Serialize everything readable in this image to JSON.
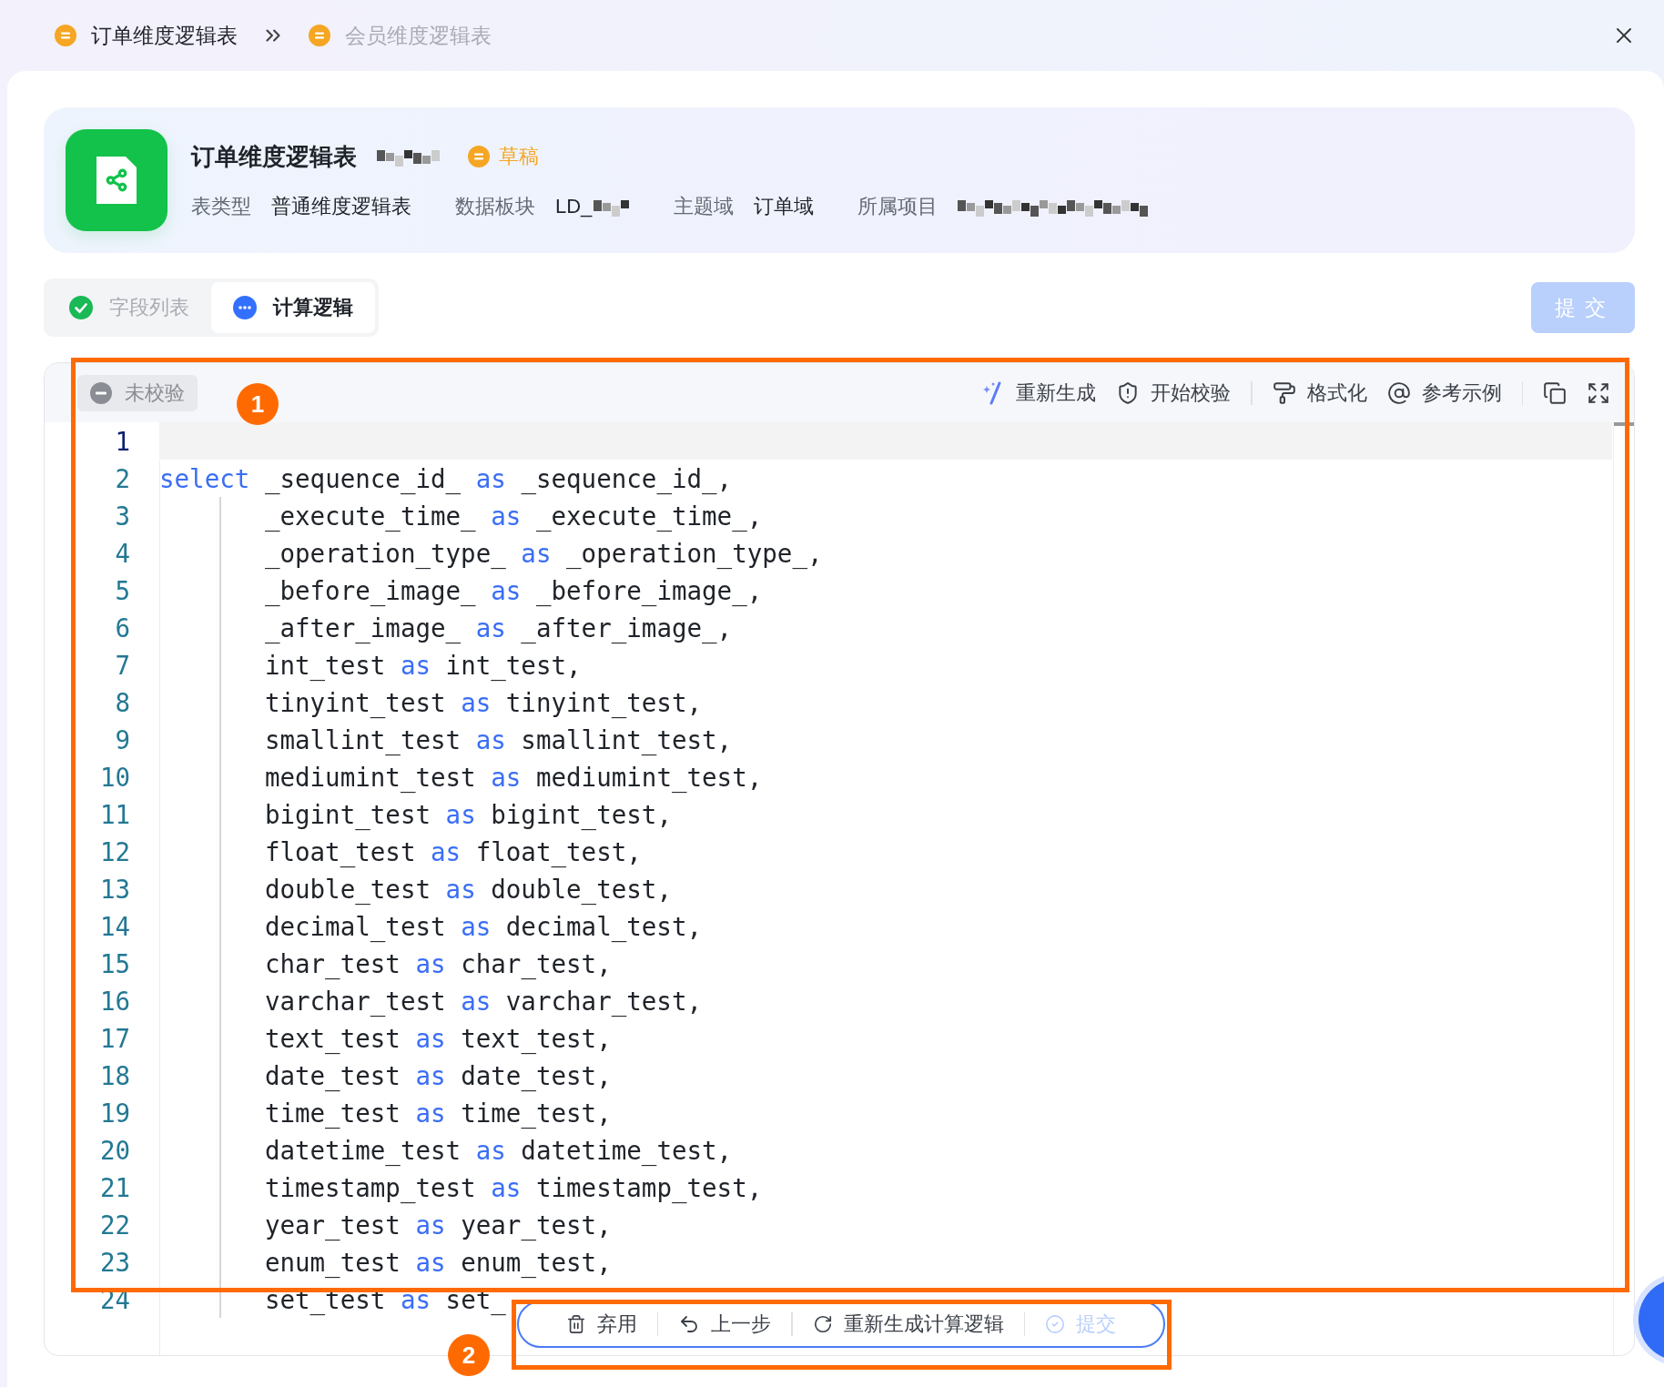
{
  "breadcrumb": [
    {
      "label": "订单维度逻辑表",
      "selected": true
    },
    {
      "label": "会员维度逻辑表",
      "selected": false
    }
  ],
  "header": {
    "title": "订单维度逻辑表",
    "title_redacted": true,
    "status": {
      "label": "草稿",
      "color": "#f5a623"
    },
    "meta": [
      {
        "label": "表类型",
        "value": "普通维度逻辑表",
        "redacted": false
      },
      {
        "label": "数据板块",
        "value": "LD_",
        "redacted": true
      },
      {
        "label": "主题域",
        "value": "订单域",
        "redacted": false
      },
      {
        "label": "所属项目",
        "redacted": true
      }
    ]
  },
  "steps": [
    {
      "label": "字段列表",
      "selected": false
    },
    {
      "label": "计算逻辑",
      "selected": true
    }
  ],
  "submit": {
    "label": "提交",
    "disabled": true
  },
  "editor": {
    "validation": {
      "label": "未校验"
    },
    "toolbar": [
      [
        {
          "kind": "regenerate",
          "label": "重新生成"
        },
        {
          "kind": "validate",
          "label": "开始校验"
        }
      ],
      [
        {
          "kind": "format",
          "label": "格式化"
        },
        {
          "kind": "example",
          "label": "参考示例"
        }
      ],
      [
        {
          "kind": "copy"
        },
        {
          "kind": "fullscreen"
        }
      ]
    ],
    "lines": [
      {
        "number": "1",
        "active": true,
        "indented": false
      },
      {
        "number": "2",
        "active": false,
        "indented": false,
        "parts": [
          {
            "kind": "keyword",
            "text": "select"
          },
          {
            "kind": "name",
            "text": " _sequence_id_ "
          },
          {
            "kind": "keyword",
            "text": "as"
          },
          {
            "kind": "name",
            "text": " _sequence_id_,"
          }
        ]
      },
      {
        "number": "3",
        "active": false,
        "indented": true,
        "parts": [
          {
            "kind": "name",
            "text": "_execute_time_ "
          },
          {
            "kind": "keyword",
            "text": "as"
          },
          {
            "kind": "name",
            "text": " _execute_time_,"
          }
        ]
      },
      {
        "number": "4",
        "active": false,
        "indented": true,
        "parts": [
          {
            "kind": "name",
            "text": "_operation_type_ "
          },
          {
            "kind": "keyword",
            "text": "as"
          },
          {
            "kind": "name",
            "text": " _operation_type_,"
          }
        ]
      },
      {
        "number": "5",
        "active": false,
        "indented": true,
        "parts": [
          {
            "kind": "name",
            "text": "_before_image_ "
          },
          {
            "kind": "keyword",
            "text": "as"
          },
          {
            "kind": "name",
            "text": " _before_image_,"
          }
        ]
      },
      {
        "number": "6",
        "active": false,
        "indented": true,
        "parts": [
          {
            "kind": "name",
            "text": "_after_image_ "
          },
          {
            "kind": "keyword",
            "text": "as"
          },
          {
            "kind": "name",
            "text": " _after_image_,"
          }
        ]
      },
      {
        "number": "7",
        "active": false,
        "indented": true,
        "parts": [
          {
            "kind": "name",
            "text": "int_test "
          },
          {
            "kind": "keyword",
            "text": "as"
          },
          {
            "kind": "name",
            "text": " int_test,"
          }
        ]
      },
      {
        "number": "8",
        "active": false,
        "indented": true,
        "parts": [
          {
            "kind": "name",
            "text": "tinyint_test "
          },
          {
            "kind": "keyword",
            "text": "as"
          },
          {
            "kind": "name",
            "text": " tinyint_test,"
          }
        ]
      },
      {
        "number": "9",
        "active": false,
        "indented": true,
        "parts": [
          {
            "kind": "name",
            "text": "smallint_test "
          },
          {
            "kind": "keyword",
            "text": "as"
          },
          {
            "kind": "name",
            "text": " smallint_test,"
          }
        ]
      },
      {
        "number": "10",
        "active": false,
        "indented": true,
        "parts": [
          {
            "kind": "name",
            "text": "mediumint_test "
          },
          {
            "kind": "keyword",
            "text": "as"
          },
          {
            "kind": "name",
            "text": " mediumint_test,"
          }
        ]
      },
      {
        "number": "11",
        "active": false,
        "indented": true,
        "parts": [
          {
            "kind": "name",
            "text": "bigint_test "
          },
          {
            "kind": "keyword",
            "text": "as"
          },
          {
            "kind": "name",
            "text": " bigint_test,"
          }
        ]
      },
      {
        "number": "12",
        "active": false,
        "indented": true,
        "parts": [
          {
            "kind": "name",
            "text": "float_test "
          },
          {
            "kind": "keyword",
            "text": "as"
          },
          {
            "kind": "name",
            "text": " float_test,"
          }
        ]
      },
      {
        "number": "13",
        "active": false,
        "indented": true,
        "parts": [
          {
            "kind": "name",
            "text": "double_test "
          },
          {
            "kind": "keyword",
            "text": "as"
          },
          {
            "kind": "name",
            "text": " double_test,"
          }
        ]
      },
      {
        "number": "14",
        "active": false,
        "indented": true,
        "parts": [
          {
            "kind": "name",
            "text": "decimal_test "
          },
          {
            "kind": "keyword",
            "text": "as"
          },
          {
            "kind": "name",
            "text": " decimal_test,"
          }
        ]
      },
      {
        "number": "15",
        "active": false,
        "indented": true,
        "parts": [
          {
            "kind": "name",
            "text": "char_test "
          },
          {
            "kind": "keyword",
            "text": "as"
          },
          {
            "kind": "name",
            "text": " char_test,"
          }
        ]
      },
      {
        "number": "16",
        "active": false,
        "indented": true,
        "parts": [
          {
            "kind": "name",
            "text": "varchar_test "
          },
          {
            "kind": "keyword",
            "text": "as"
          },
          {
            "kind": "name",
            "text": " varchar_test,"
          }
        ]
      },
      {
        "number": "17",
        "active": false,
        "indented": true,
        "parts": [
          {
            "kind": "name",
            "text": "text_test "
          },
          {
            "kind": "keyword",
            "text": "as"
          },
          {
            "kind": "name",
            "text": " text_test,"
          }
        ]
      },
      {
        "number": "18",
        "active": false,
        "indented": true,
        "parts": [
          {
            "kind": "name",
            "text": "date_test "
          },
          {
            "kind": "keyword",
            "text": "as"
          },
          {
            "kind": "name",
            "text": " date_test,"
          }
        ]
      },
      {
        "number": "19",
        "active": false,
        "indented": true,
        "parts": [
          {
            "kind": "name",
            "text": "time_test "
          },
          {
            "kind": "keyword",
            "text": "as"
          },
          {
            "kind": "name",
            "text": " time_test,"
          }
        ]
      },
      {
        "number": "20",
        "active": false,
        "indented": true,
        "parts": [
          {
            "kind": "name",
            "text": "datetime_test "
          },
          {
            "kind": "keyword",
            "text": "as"
          },
          {
            "kind": "name",
            "text": " datetime_test,"
          }
        ]
      },
      {
        "number": "21",
        "active": false,
        "indented": true,
        "parts": [
          {
            "kind": "name",
            "text": "timestamp_test "
          },
          {
            "kind": "keyword",
            "text": "as"
          },
          {
            "kind": "name",
            "text": " timestamp_test,"
          }
        ]
      },
      {
        "number": "22",
        "active": false,
        "indented": true,
        "parts": [
          {
            "kind": "name",
            "text": "year_test "
          },
          {
            "kind": "keyword",
            "text": "as"
          },
          {
            "kind": "name",
            "text": " year_test,"
          }
        ]
      },
      {
        "number": "23",
        "active": false,
        "indented": true,
        "parts": [
          {
            "kind": "name",
            "text": "enum_test "
          },
          {
            "kind": "keyword",
            "text": "as"
          },
          {
            "kind": "name",
            "text": " enum_test,"
          }
        ]
      },
      {
        "number": "24",
        "active": false,
        "indented": true,
        "parts": [
          {
            "kind": "name",
            "text": "set_test "
          },
          {
            "kind": "keyword",
            "text": "as"
          },
          {
            "kind": "name",
            "text": " set_"
          }
        ]
      }
    ]
  },
  "action_bar": [
    {
      "kind": "discard",
      "label": "弃用",
      "disabled": false
    },
    {
      "kind": "back",
      "label": "上一步",
      "disabled": false
    },
    {
      "kind": "regenerate",
      "label": "重新生成计算逻辑",
      "disabled": false
    },
    {
      "kind": "submit",
      "label": "提交",
      "disabled": true
    }
  ],
  "annotations": [
    {
      "number": "1"
    },
    {
      "number": "2"
    }
  ]
}
